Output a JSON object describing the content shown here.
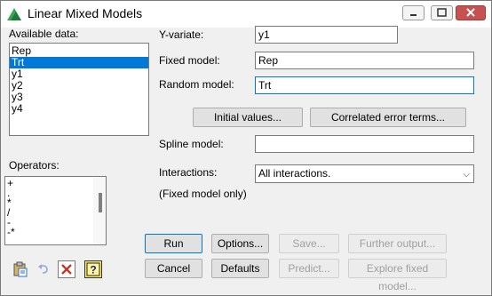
{
  "window": {
    "title": "Linear Mixed Models"
  },
  "available_data": {
    "label": "Available data:",
    "items": [
      "Rep",
      "Trt",
      "y1",
      "y2",
      "y3",
      "y4"
    ],
    "selected_index": 1
  },
  "operators": {
    "label": "Operators:",
    "items": [
      "+",
      ".",
      "*",
      "/",
      "-",
      "-*"
    ]
  },
  "y_variate": {
    "label": "Y-variate:",
    "value": "y1"
  },
  "fixed_model": {
    "label": "Fixed model:",
    "value": "Rep"
  },
  "random_model": {
    "label": "Random model:",
    "value": "Trt"
  },
  "buttons": {
    "initial_values": "Initial values...",
    "correlated_error_terms": "Correlated error terms...",
    "run": "Run",
    "options": "Options...",
    "save": "Save...",
    "further_output": "Further output...",
    "cancel": "Cancel",
    "defaults": "Defaults",
    "predict": "Predict...",
    "explore_fixed_model": "Explore fixed model..."
  },
  "spline_model": {
    "label": "Spline model:",
    "value": ""
  },
  "interactions": {
    "label": "Interactions:",
    "value": "All interactions.",
    "note": "(Fixed model only)"
  },
  "colors": {
    "selection": "#0078d7",
    "close_button": "#c75050"
  },
  "toolbar_icons": [
    "paste-icon",
    "undo-icon",
    "clear-icon",
    "help-icon"
  ]
}
